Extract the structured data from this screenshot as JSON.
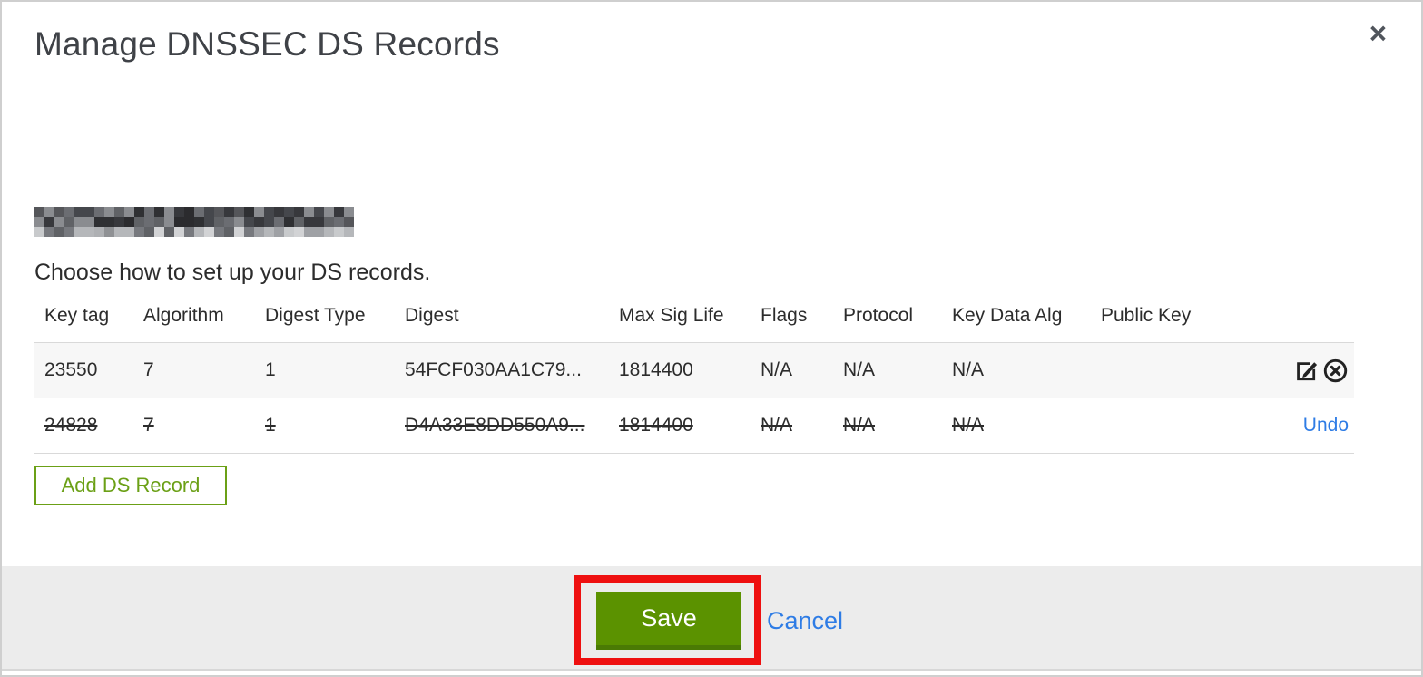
{
  "colors": {
    "button_green": "#5b9200",
    "button_green_dark": "#4a7a04",
    "outline_green": "#6ba016",
    "link_blue": "#2e7ce5",
    "annotation_red": "#ee1010",
    "row_shade": "#f7f7f7",
    "footer_bg": "#ececec"
  },
  "modal": {
    "title": "Manage DNSSEC DS Records",
    "close_icon": "×",
    "domain_redacted": true,
    "instruction": "Choose how to set up your DS records.",
    "table": {
      "columns": [
        "Key tag",
        "Algorithm",
        "Digest Type",
        "Digest",
        "Max Sig Life",
        "Flags",
        "Protocol",
        "Key Data Alg",
        "Public Key"
      ],
      "rows": [
        {
          "key_tag": "23550",
          "algorithm": "7",
          "digest_type": "1",
          "digest": "54FCF030AA1C79...",
          "max_sig_life": "1814400",
          "flags": "N/A",
          "protocol": "N/A",
          "key_data_alg": "N/A",
          "public_key": "",
          "state": "active",
          "actions": [
            "edit",
            "delete"
          ]
        },
        {
          "key_tag": "24828",
          "algorithm": "7",
          "digest_type": "1",
          "digest": "D4A33E8DD550A9...",
          "max_sig_life": "1814400",
          "flags": "N/A",
          "protocol": "N/A",
          "key_data_alg": "N/A",
          "public_key": "",
          "state": "deleted",
          "undo_label": "Undo"
        }
      ]
    },
    "add_ds_record_label": "Add DS Record",
    "footer": {
      "save_label": "Save",
      "cancel_label": "Cancel"
    }
  }
}
